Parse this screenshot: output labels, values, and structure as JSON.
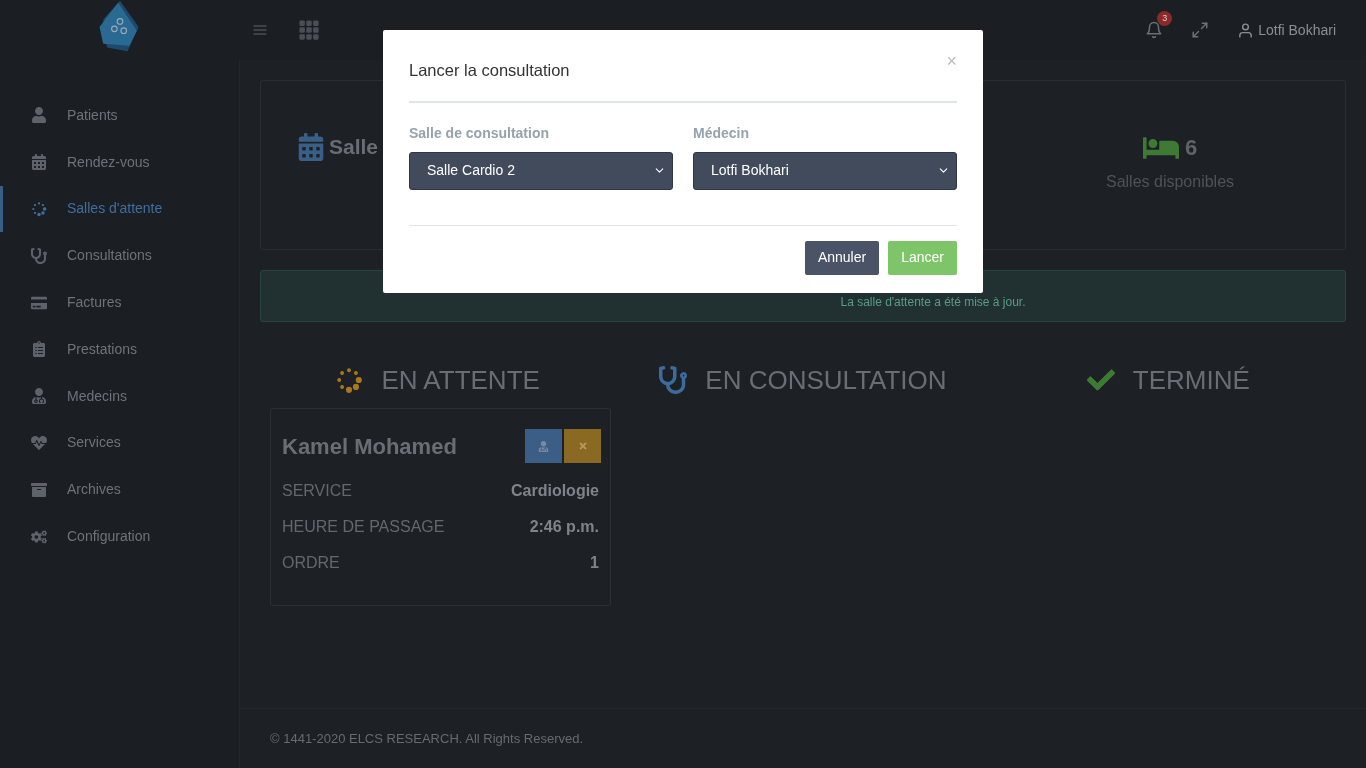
{
  "header": {
    "notifications": "3",
    "user": "Lotfi Bokhari"
  },
  "sidebar": {
    "items": [
      {
        "label": "Patients",
        "selected": false
      },
      {
        "label": "Rendez-vous",
        "selected": false
      },
      {
        "label": "Salles d'attente",
        "selected": true
      },
      {
        "label": "Consultations",
        "selected": false
      },
      {
        "label": "Factures",
        "selected": false
      },
      {
        "label": "Prestations",
        "selected": false
      },
      {
        "label": "Medecins",
        "selected": false
      },
      {
        "label": "Services",
        "selected": false
      },
      {
        "label": "Archives",
        "selected": false
      },
      {
        "label": "Configuration",
        "selected": false
      }
    ]
  },
  "stats": [
    {
      "value": "Salle"
    },
    {
      "value": "6",
      "label": "Salles disponibles"
    }
  ],
  "alert": "La salle d'attente a été mise à jour.",
  "columns": [
    {
      "title": "EN ATTENTE",
      "cards": [
        {
          "name": "Kamel Mohamed",
          "fields": [
            {
              "label": "SERVICE",
              "value": "Cardiologie"
            },
            {
              "label": "HEURE DE PASSAGE",
              "value": "2:46 p.m."
            },
            {
              "label": "ORDRE",
              "value": "1"
            }
          ]
        }
      ]
    },
    {
      "title": "EN CONSULTATION"
    },
    {
      "title": "TERMINÉ"
    }
  ],
  "footer": "© 1441-2020 ELCS RESEARCH. All Rights Reserved.",
  "modal": {
    "title": "Lancer la consultation",
    "close": "×",
    "fields": [
      {
        "label": "Salle de consultation",
        "value": "Salle Cardio 2"
      },
      {
        "label": "Médecin",
        "value": "Lotfi Bokhari"
      }
    ],
    "buttons": [
      {
        "label": "Annuler",
        "kind": "secondary"
      },
      {
        "label": "Lancer",
        "kind": "primary"
      }
    ]
  }
}
